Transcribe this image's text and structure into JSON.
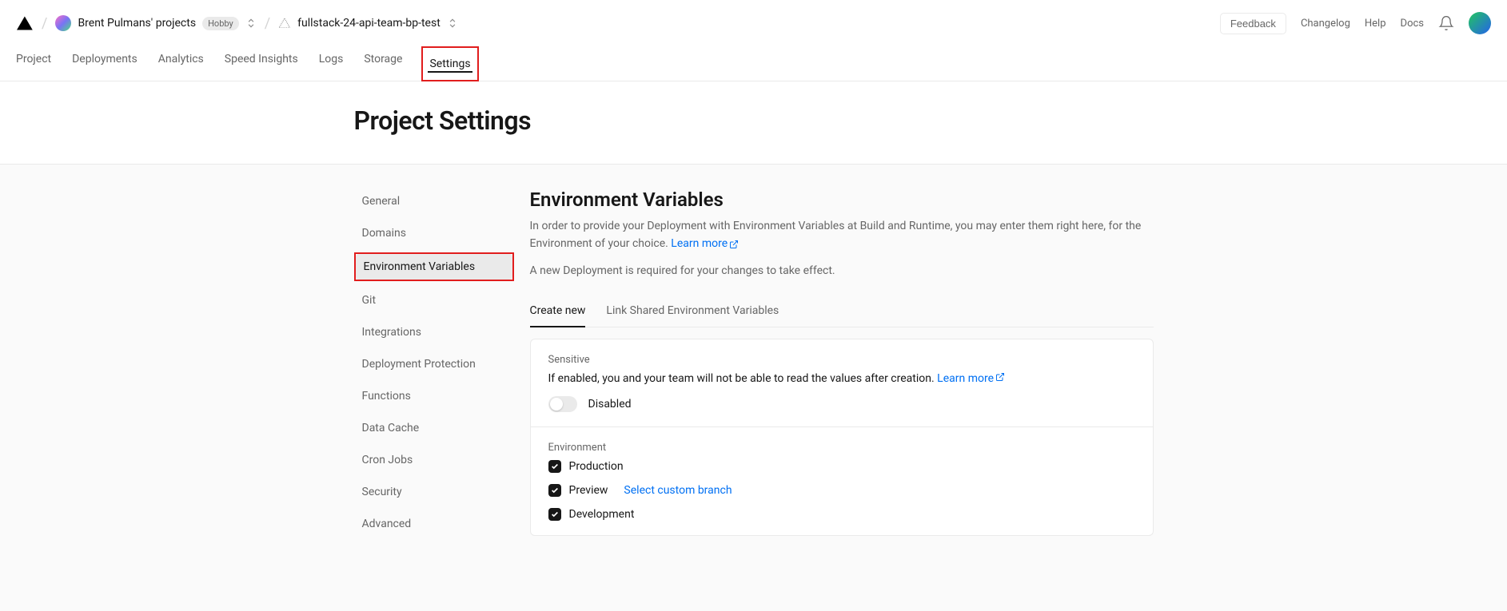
{
  "header": {
    "team_name": "Brent Pulmans' projects",
    "plan_badge": "Hobby",
    "project_name": "fullstack-24-api-team-bp-test",
    "feedback": "Feedback",
    "links": [
      "Changelog",
      "Help",
      "Docs"
    ]
  },
  "nav": {
    "items": [
      "Project",
      "Deployments",
      "Analytics",
      "Speed Insights",
      "Logs",
      "Storage",
      "Settings"
    ],
    "active": "Settings"
  },
  "page": {
    "title": "Project Settings"
  },
  "sidebar": {
    "items": [
      "General",
      "Domains",
      "Environment Variables",
      "Git",
      "Integrations",
      "Deployment Protection",
      "Functions",
      "Data Cache",
      "Cron Jobs",
      "Security",
      "Advanced"
    ],
    "active": "Environment Variables"
  },
  "content": {
    "heading": "Environment Variables",
    "description_pre": "In order to provide your Deployment with Environment Variables at Build and Runtime, you may enter them right here, for the Environment of your choice. ",
    "learn_more": "Learn more",
    "note": "A new Deployment is required for your changes to take effect.",
    "subtabs": [
      "Create new",
      "Link Shared Environment Variables"
    ],
    "subtab_active": "Create new",
    "sensitive": {
      "label": "Sensitive",
      "text_pre": "If enabled, you and your team will not be able to read the values after creation. ",
      "learn_more": "Learn more",
      "toggle_state": "Disabled"
    },
    "environment": {
      "label": "Environment",
      "options": [
        {
          "name": "Production",
          "checked": true
        },
        {
          "name": "Preview",
          "checked": true,
          "branch_link": "Select custom branch"
        },
        {
          "name": "Development",
          "checked": true
        }
      ]
    }
  }
}
